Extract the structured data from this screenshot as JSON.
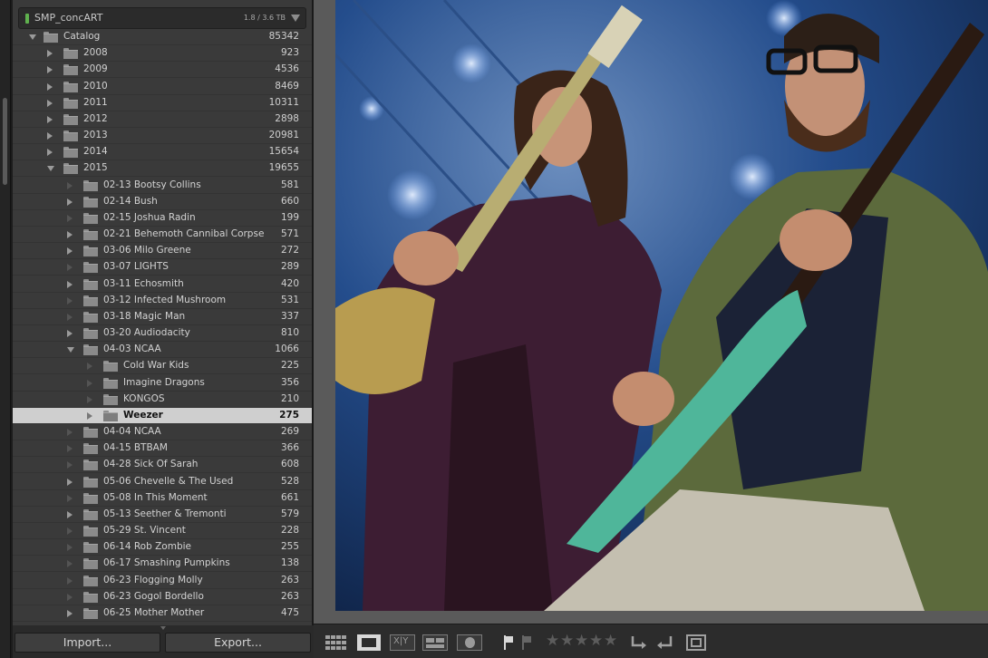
{
  "volume": {
    "name": "SMP_concART",
    "usage": "1.8 / 3.6 TB"
  },
  "folders": [
    {
      "label": "Catalog",
      "count": "85342",
      "level": 0,
      "arrow": "down"
    },
    {
      "label": "2008",
      "count": "923",
      "level": 1,
      "arrow": "right"
    },
    {
      "label": "2009",
      "count": "4536",
      "level": 1,
      "arrow": "right"
    },
    {
      "label": "2010",
      "count": "8469",
      "level": 1,
      "arrow": "right"
    },
    {
      "label": "2011",
      "count": "10311",
      "level": 1,
      "arrow": "right"
    },
    {
      "label": "2012",
      "count": "2898",
      "level": 1,
      "arrow": "right"
    },
    {
      "label": "2013",
      "count": "20981",
      "level": 1,
      "arrow": "right"
    },
    {
      "label": "2014",
      "count": "15654",
      "level": 1,
      "arrow": "right"
    },
    {
      "label": "2015",
      "count": "19655",
      "level": 1,
      "arrow": "down"
    },
    {
      "label": "02-13 Bootsy Collins",
      "count": "581",
      "level": 2,
      "arrow": "dim"
    },
    {
      "label": "02-14 Bush",
      "count": "660",
      "level": 2,
      "arrow": "right"
    },
    {
      "label": "02-15 Joshua Radin",
      "count": "199",
      "level": 2,
      "arrow": "dim"
    },
    {
      "label": "02-21 Behemoth Cannibal Corpse",
      "count": "571",
      "level": 2,
      "arrow": "right"
    },
    {
      "label": "03-06 Milo Greene",
      "count": "272",
      "level": 2,
      "arrow": "right"
    },
    {
      "label": "03-07 LIGHTS",
      "count": "289",
      "level": 2,
      "arrow": "dim"
    },
    {
      "label": "03-11 Echosmith",
      "count": "420",
      "level": 2,
      "arrow": "right"
    },
    {
      "label": "03-12 Infected Mushroom",
      "count": "531",
      "level": 2,
      "arrow": "dim"
    },
    {
      "label": "03-18 Magic Man",
      "count": "337",
      "level": 2,
      "arrow": "dim"
    },
    {
      "label": "03-20 Audiodacity",
      "count": "810",
      "level": 2,
      "arrow": "right"
    },
    {
      "label": "04-03 NCAA",
      "count": "1066",
      "level": 2,
      "arrow": "down"
    },
    {
      "label": "Cold War Kids",
      "count": "225",
      "level": 3,
      "arrow": "dim"
    },
    {
      "label": "Imagine Dragons",
      "count": "356",
      "level": 3,
      "arrow": "dim"
    },
    {
      "label": "KONGOS",
      "count": "210",
      "level": 3,
      "arrow": "dim"
    },
    {
      "label": "Weezer",
      "count": "275",
      "level": 3,
      "arrow": "dim",
      "selected": true
    },
    {
      "label": "04-04 NCAA",
      "count": "269",
      "level": 2,
      "arrow": "dim"
    },
    {
      "label": "04-15 BTBAM",
      "count": "366",
      "level": 2,
      "arrow": "dim"
    },
    {
      "label": "04-28 Sick Of Sarah",
      "count": "608",
      "level": 2,
      "arrow": "dim"
    },
    {
      "label": "05-06 Chevelle & The Used",
      "count": "528",
      "level": 2,
      "arrow": "right"
    },
    {
      "label": "05-08 In This Moment",
      "count": "661",
      "level": 2,
      "arrow": "dim"
    },
    {
      "label": "05-13 Seether & Tremonti",
      "count": "579",
      "level": 2,
      "arrow": "right"
    },
    {
      "label": "05-29 St. Vincent",
      "count": "228",
      "level": 2,
      "arrow": "dim"
    },
    {
      "label": "06-14 Rob Zombie",
      "count": "255",
      "level": 2,
      "arrow": "dim"
    },
    {
      "label": "06-17 Smashing Pumpkins",
      "count": "138",
      "level": 2,
      "arrow": "dim"
    },
    {
      "label": "06-23 Flogging Molly",
      "count": "263",
      "level": 2,
      "arrow": "dim"
    },
    {
      "label": "06-23 Gogol Bordello",
      "count": "263",
      "level": 2,
      "arrow": "dim"
    },
    {
      "label": "06-25 Mother Mother",
      "count": "475",
      "level": 2,
      "arrow": "right"
    }
  ],
  "buttons": {
    "import": "Import...",
    "export": "Export..."
  },
  "toolbar": {
    "icons": [
      "grid-view-icon",
      "loupe-view-icon",
      "compare-view-icon",
      "survey-view-icon",
      "people-view-icon",
      "flag-pick-icon",
      "flag-reject-icon",
      "rotate-left-icon",
      "rotate-right-icon",
      "crop-overlay-icon"
    ],
    "stars": [
      "★",
      "★",
      "★",
      "★",
      "★"
    ],
    "compare_label": "X|Y"
  },
  "colors": {
    "panel": "#3a3a3a",
    "selected_row": "#cfcfcf",
    "volume_indicator": "#5fb14e",
    "stage_background": "#142a4e"
  }
}
